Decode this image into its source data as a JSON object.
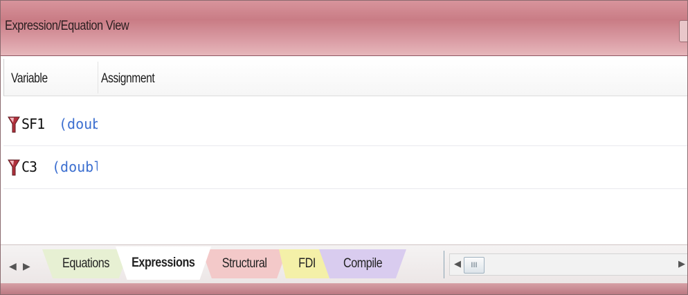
{
  "window": {
    "title": "Expression/Equation View"
  },
  "table": {
    "columns": [
      "Variable",
      "Assignment"
    ],
    "rows": [
      {
        "name": "SF1",
        "type": "(doubl",
        "icon": "funnel-icon"
      },
      {
        "name": "C3",
        "type": "(double",
        "icon": "funnel-icon"
      }
    ]
  },
  "tabs": [
    {
      "label": "Equations",
      "color": "#e7f0d3"
    },
    {
      "label": "Expressions",
      "color": "#ffffff",
      "active": true
    },
    {
      "label": "Structural",
      "color": "#f3c9c9"
    },
    {
      "label": "FDI",
      "color": "#f4f0a8"
    },
    {
      "label": "Compile",
      "color": "#d9ccef"
    }
  ],
  "scrollbar": {
    "thumb_glyph": "III"
  },
  "colors": {
    "type_text": "#3c6fd0",
    "titlebar": "#c97c85"
  }
}
